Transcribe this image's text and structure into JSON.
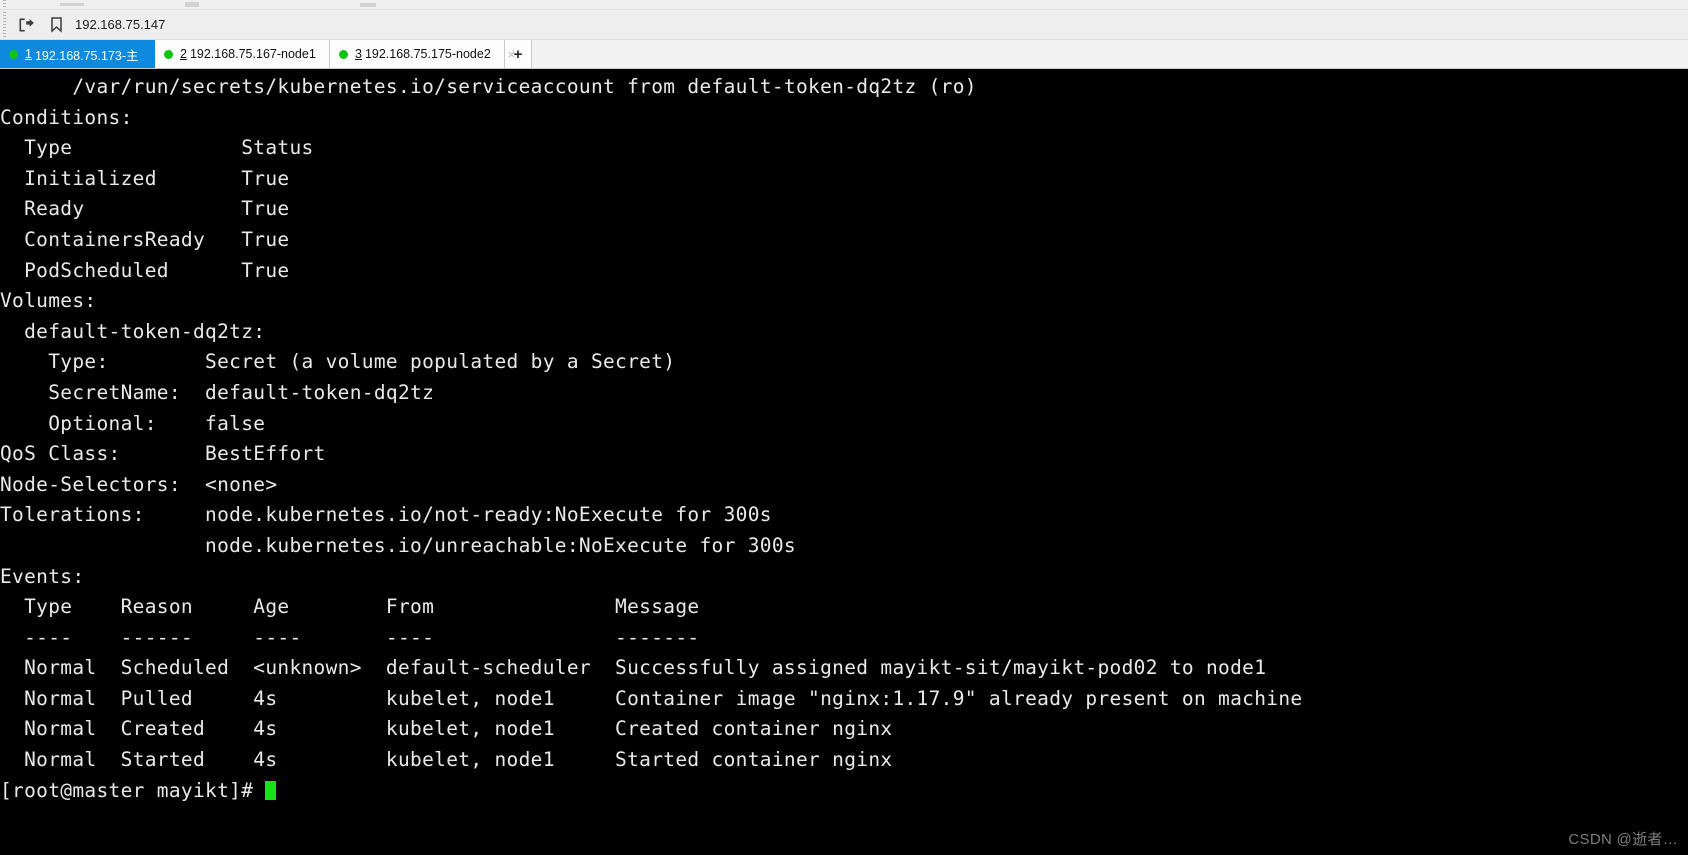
{
  "window": {
    "toolbar": {
      "export_icon": "export-arrow-icon",
      "bookmark_icon": "bookmark-icon",
      "address": "192.168.75.147"
    },
    "tabs": [
      {
        "index": "1",
        "title": "192.168.75.173-主",
        "status": "connected",
        "active": true,
        "close": "×"
      },
      {
        "index": "2",
        "title": "192.168.75.167-node1",
        "status": "connected",
        "active": false,
        "close": "×"
      },
      {
        "index": "3",
        "title": "192.168.75.175-node2",
        "status": "connected",
        "active": false,
        "close": "×"
      }
    ],
    "new_tab_label": "+"
  },
  "colors": {
    "active_tab": "#0d8ae0",
    "status_dot": "#12c412",
    "terminal_bg": "#000000",
    "terminal_fg": "#e9e9e9",
    "cursor": "#19e019"
  },
  "terminal": {
    "lines": [
      "      /var/run/secrets/kubernetes.io/serviceaccount from default-token-dq2tz (ro)",
      "Conditions:",
      "  Type              Status",
      "  Initialized       True",
      "  Ready             True",
      "  ContainersReady   True",
      "  PodScheduled      True",
      "Volumes:",
      "  default-token-dq2tz:",
      "    Type:        Secret (a volume populated by a Secret)",
      "    SecretName:  default-token-dq2tz",
      "    Optional:    false",
      "QoS Class:       BestEffort",
      "Node-Selectors:  <none>",
      "Tolerations:     node.kubernetes.io/not-ready:NoExecute for 300s",
      "                 node.kubernetes.io/unreachable:NoExecute for 300s",
      "Events:",
      "  Type    Reason     Age        From               Message",
      "  ----    ------     ----       ----               -------",
      "  Normal  Scheduled  <unknown>  default-scheduler  Successfully assigned mayikt-sit/mayikt-pod02 to node1",
      "  Normal  Pulled     4s         kubelet, node1     Container image \"nginx:1.17.9\" already present on machine",
      "  Normal  Created    4s         kubelet, node1     Created container nginx",
      "  Normal  Started    4s         kubelet, node1     Started container nginx"
    ],
    "prompt": "[root@master mayikt]# "
  },
  "watermark": "CSDN @逝者…"
}
